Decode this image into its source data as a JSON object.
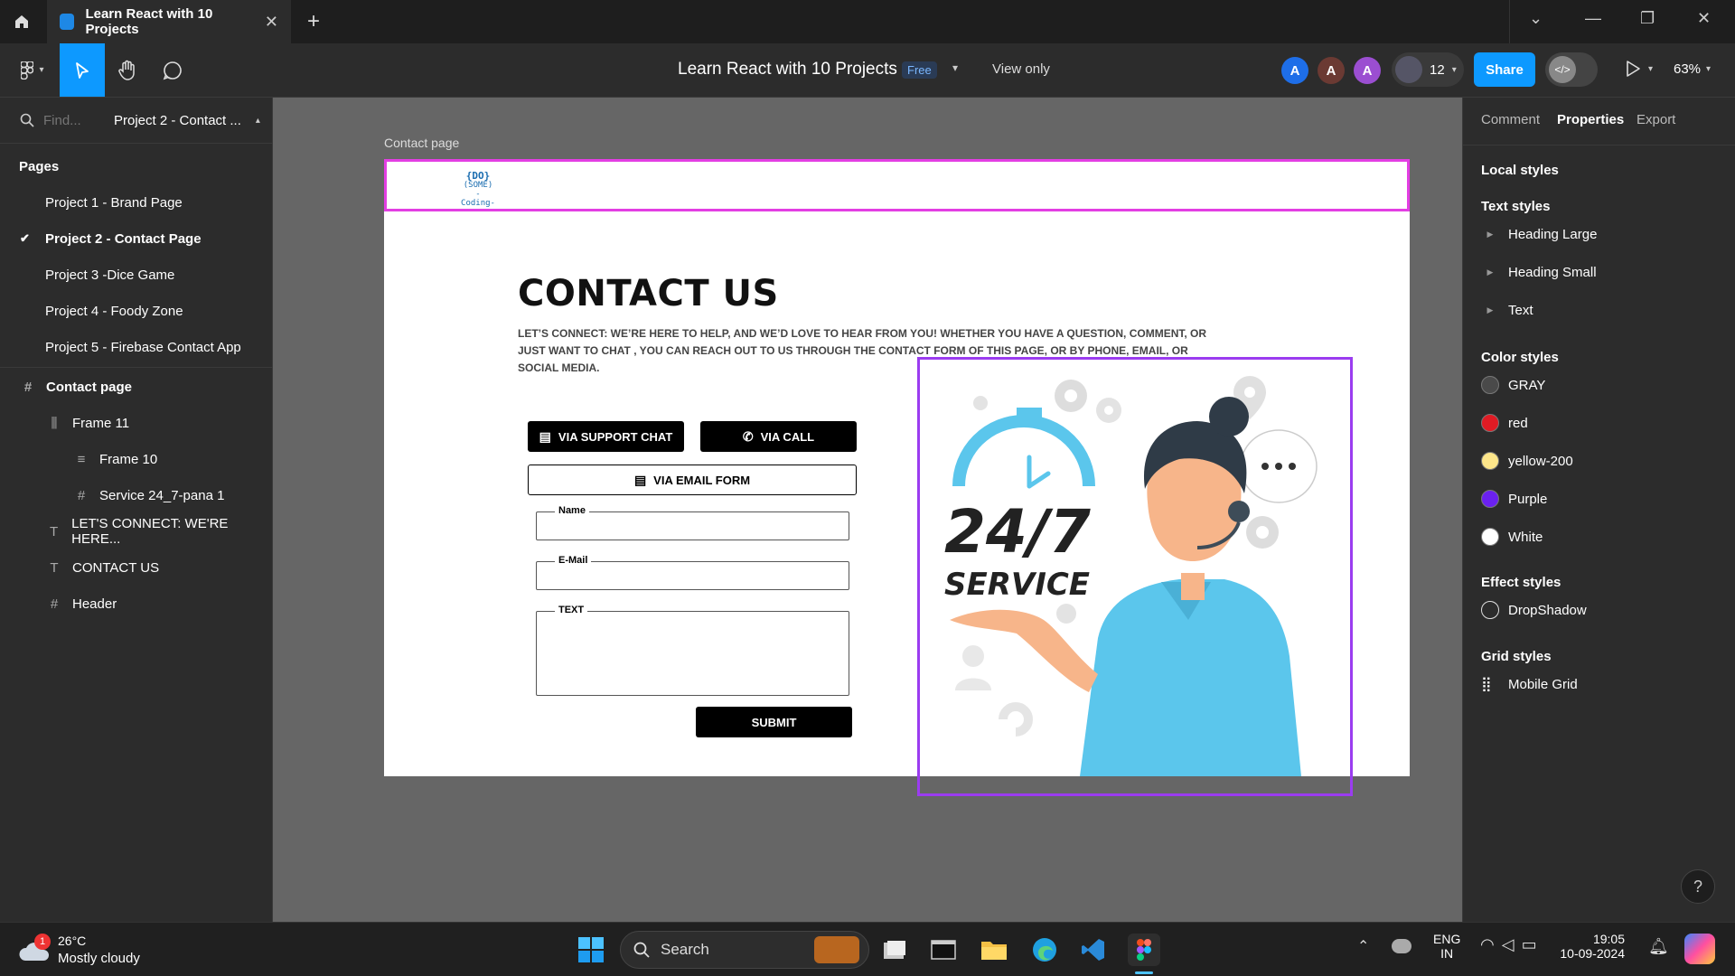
{
  "window": {
    "tab_title": "Learn React with 10 Projects",
    "tab_close": "✕",
    "new_tab": "+",
    "min": "—",
    "restore": "❐",
    "close": "✕"
  },
  "toolbar": {
    "file_title": "Learn React with 10 Projects",
    "plan_badge": "Free",
    "view_mode": "View only",
    "avatars": [
      "A",
      "A",
      "A"
    ],
    "avatar_colors": [
      "#1e6ee8",
      "#6b3a33",
      "#9b4ed1"
    ],
    "collaborator_count": "12",
    "share_label": "Share",
    "zoom": "63%"
  },
  "left_panel": {
    "search_placeholder": "Find...",
    "current_page": "Project 2 - Contact ...",
    "pages_heading": "Pages",
    "pages": [
      {
        "label": "Project 1 - Brand Page",
        "selected": false
      },
      {
        "label": "Project 2 - Contact Page",
        "selected": true
      },
      {
        "label": "Project 3 -Dice Game",
        "selected": false
      },
      {
        "label": "Project 4 - Foody Zone",
        "selected": false
      },
      {
        "label": "Project 5 - Firebase Contact App",
        "selected": false
      }
    ],
    "layers": [
      {
        "label": "Contact page",
        "icon": "#",
        "depth": 0,
        "bold": true
      },
      {
        "label": "Frame 11",
        "icon": "⫼",
        "depth": 1,
        "bold": false
      },
      {
        "label": "Frame 10",
        "icon": "≡",
        "depth": 2,
        "bold": false
      },
      {
        "label": "Service 24_7-pana 1",
        "icon": "#",
        "depth": 2,
        "bold": false
      },
      {
        "label": "LET'S CONNECT: WE'RE HERE...",
        "icon": "T",
        "depth": 1,
        "bold": false
      },
      {
        "label": "CONTACT US",
        "icon": "T",
        "depth": 1,
        "bold": false
      },
      {
        "label": "Header",
        "icon": "#",
        "depth": 1,
        "bold": false
      }
    ]
  },
  "canvas": {
    "frame_label": "Contact page",
    "logo_lines": [
      "{DO}",
      "(SOME)",
      "-Coding-"
    ],
    "title": "CONTACT US",
    "description": "LET’S CONNECT: WE’RE HERE TO HELP, AND WE’D LOVE TO HEAR FROM YOU! WHETHER YOU HAVE A QUESTION, COMMENT, OR JUST WANT TO CHAT , YOU CAN REACH OUT TO US THROUGH THE CONTACT FORM OF THIS PAGE, OR BY PHONE, EMAIL, OR SOCIAL MEDIA.",
    "btn_support_chat": "VIA SUPPORT CHAT",
    "btn_call": "VIA CALL",
    "btn_email_form": "VIA EMAIL FORM",
    "field_name": "Name",
    "field_email": "E-Mail",
    "field_text": "TEXT",
    "btn_submit": "SUBMIT",
    "illus_line1": "24/7",
    "illus_line2": "SERVICE"
  },
  "right_panel": {
    "tabs": [
      "Comment",
      "Properties",
      "Export"
    ],
    "active_tab": "Properties",
    "local_styles": "Local styles",
    "text_styles_heading": "Text styles",
    "text_styles": [
      "Heading Large",
      "Heading Small",
      "Text"
    ],
    "color_styles_heading": "Color styles",
    "color_styles": [
      {
        "name": "GRAY",
        "color": "#4a4a4a"
      },
      {
        "name": "red",
        "color": "#e01b24"
      },
      {
        "name": "yellow-200",
        "color": "#fde68a"
      },
      {
        "name": "Purple",
        "color": "#6b21f0"
      },
      {
        "name": "White",
        "color": "#ffffff"
      }
    ],
    "effect_styles_heading": "Effect styles",
    "effect_styles": [
      "DropShadow"
    ],
    "grid_styles_heading": "Grid styles",
    "grid_styles": [
      "Mobile Grid"
    ],
    "help": "?"
  },
  "taskbar": {
    "weather_temp": "26°C",
    "weather_desc": "Mostly cloudy",
    "weather_badge": "1",
    "search_label": "Search",
    "lang_line1": "ENG",
    "lang_line2": "IN",
    "time": "19:05",
    "date": "10-09-2024"
  }
}
